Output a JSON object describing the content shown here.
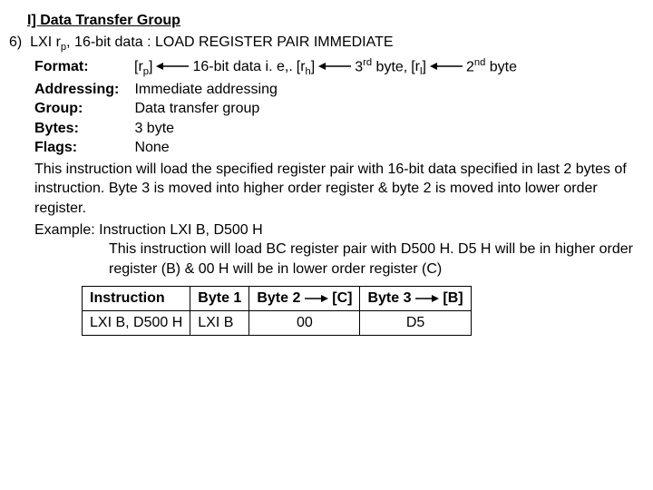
{
  "title": "I] Data Transfer Group",
  "item_number": "6)",
  "mnemonic_prefix": "LXI r",
  "mnemonic_sub": "p",
  "mnemonic_rest": ", 16-bit data  :",
  "mnemonic_desc": "LOAD REGISTER PAIR IMMEDIATE",
  "format_label": "Format:",
  "format_rp_open": "[r",
  "format_rp_sub": "p",
  "format_rp_close": "]",
  "format_mid": "16-bit data   i. e,.",
  "format_rh_open": "[r",
  "format_rh_sub": "h",
  "format_rh_close": "]",
  "format_byte3_pre": "3",
  "format_byte3_sup": "rd",
  "format_byte3_post": " byte,",
  "format_rl_open": "[r",
  "format_rl_sub": "l",
  "format_rl_close": "]",
  "format_byte2_pre": "2",
  "format_byte2_sup": "nd",
  "format_byte2_post": "  byte",
  "addressing_label": "Addressing:",
  "addressing_value": "Immediate addressing",
  "group_label": "Group:",
  "group_value": "Data transfer group",
  "bytes_label": "Bytes:",
  "bytes_value": "3 byte",
  "flags_label": "Flags:",
  "flags_value": "None",
  "desc": "This instruction will load the specified register pair with 16-bit data specified in last 2 bytes of instruction. Byte 3 is moved into higher order register & byte 2 is moved into lower order register.",
  "example_label": "Example:",
  "example_instr": "Instruction LXI B, D500 H",
  "example_desc": "This instruction will load BC register pair with D500 H. D5 H will be in higher order register (B) & 00 H will be in lower order register (C)",
  "table": {
    "h_instruction": "Instruction",
    "h_byte1": "Byte 1",
    "h_byte2": "Byte 2",
    "h_c": "[C]",
    "h_byte3": "Byte 3",
    "h_b": "[B]",
    "r_instruction": "LXI B, D500 H",
    "r_byte1": "LXI B",
    "r_byte2": "00",
    "r_byte3": "D5"
  }
}
